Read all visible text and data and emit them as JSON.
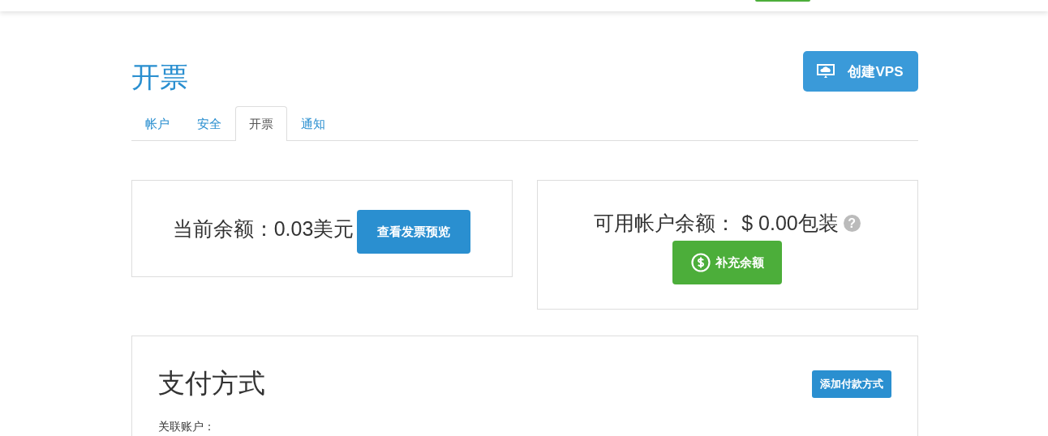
{
  "page_title": "开票",
  "create_button": {
    "label": "创建VPS"
  },
  "tabs": [
    {
      "label": "帐户",
      "selected": false
    },
    {
      "label": "安全",
      "selected": false
    },
    {
      "label": "开票",
      "selected": true
    },
    {
      "label": "通知",
      "selected": false
    }
  ],
  "balance_card": {
    "text": "当前余额：0.03美元",
    "button": "查看发票预览"
  },
  "account_card": {
    "text": "可用帐户余额： $ 0.00包装",
    "help_icon": "?",
    "button": "补充余额"
  },
  "payment": {
    "title": "支付方式",
    "button": "添加付款方式",
    "label": "关联账户："
  }
}
